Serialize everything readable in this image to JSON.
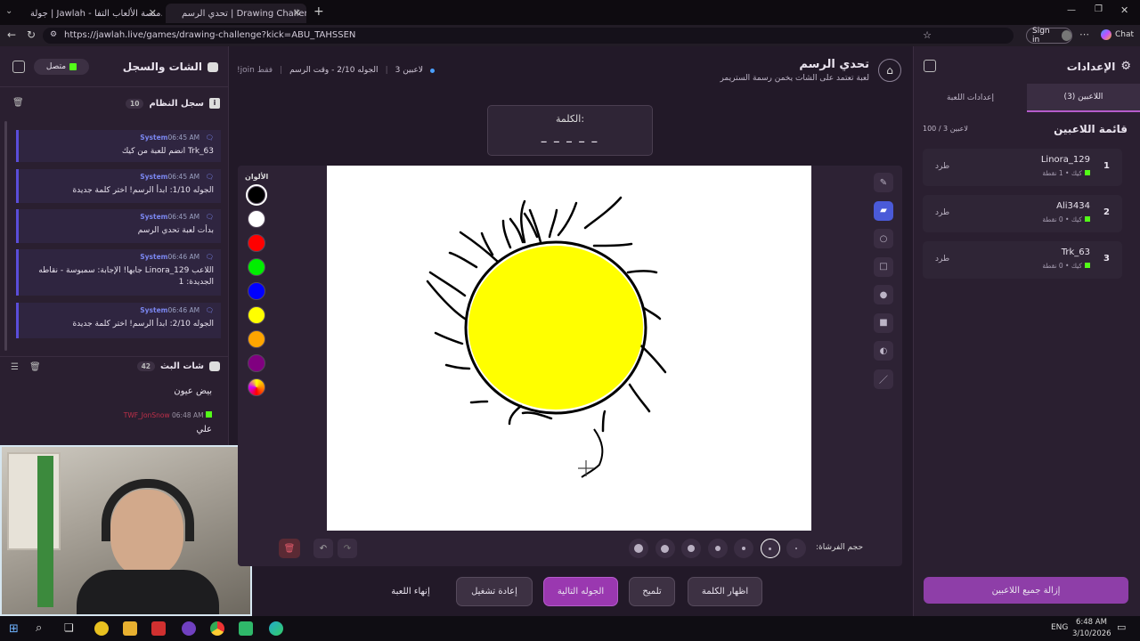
{
  "browser": {
    "tab1_title": "جولة | Jawlah - منصة الألعاب التفا...",
    "tab2_title": "تحدي الرسم | Drawing Challenge",
    "url": "https://jawlah.live/games/drawing-challenge?kick=ABU_TAHSSEN",
    "signin_label": "Sign in",
    "chat_label": "Chat"
  },
  "left_panel": {
    "title": "الشات والسجل",
    "status_label": "متصل",
    "system_log_title": "سجل النظام",
    "system_log_count": "10",
    "messages": [
      {
        "sender": "System",
        "time": "06:45 AM",
        "text": "Trk_63 انضم للعبة من كيك"
      },
      {
        "sender": "System",
        "time": "06:45 AM",
        "text": "الجوله 1/10: ابدأ الرسم! اختر كلمة جديدة"
      },
      {
        "sender": "System",
        "time": "06:45 AM",
        "text": "بدأت لعبة تحدي الرسم"
      },
      {
        "sender": "System",
        "time": "06:46 AM",
        "text": "اللاعب Linora_129 جابها! الإجابة: سمبوسة - نقاطه الجديدة: 1"
      },
      {
        "sender": "System",
        "time": "06:46 AM",
        "text": "الجوله 2/10: ابدأ الرسم! اختر كلمة جديدة"
      }
    ],
    "stream_chat_title": "شات البث",
    "stream_chat_count": "42",
    "chat_messages": [
      {
        "user": "",
        "time": "",
        "text": "بيض عيون"
      },
      {
        "user": "TWF_JonSnow",
        "time": "06:48 AM",
        "text": "علي"
      }
    ]
  },
  "game": {
    "title": "تحدي الرسم",
    "subtitle": "لعبة تعتمد على الشات يخمن رسمة الستريمر",
    "players_count": "3 لاعبين",
    "round_info": "الجوله 2/10 - وقت الرسم",
    "join_hint": "!join فقط",
    "word_label": "الكلمة:",
    "word_mask": "_ _ _ _ _",
    "colors_label": "الألوان",
    "colors": [
      "#000000",
      "#ffffff",
      "#ff0000",
      "#00ee00",
      "#0000ff",
      "#ffff00",
      "#ffa500",
      "#800080"
    ],
    "brush_size_label": "حجم الفرشاة:",
    "tools": [
      "pen-icon",
      "eraser-icon",
      "circle-outline-icon",
      "rectangle-outline-icon",
      "circle-fill-icon",
      "rectangle-fill-icon",
      "fill-bucket-icon",
      "line-icon"
    ],
    "buttons": {
      "reveal_word": "اظهار الكلمة",
      "hint": "تلميح",
      "next_round": "الجوله التالية",
      "restart": "إعادة تشغيل",
      "end_game": "إنهاء اللعبة"
    }
  },
  "right_panel": {
    "title": "الإعدادات",
    "tab_players": "اللاعبين (3)",
    "tab_game_settings": "إعدادات اللعبة",
    "players_list_title": "قائمة اللاعبين",
    "players_capacity": "100 / 3 لاعبين",
    "players": [
      {
        "rank": "1",
        "name": "Linora_129",
        "info": "كيك • 1 نقطة",
        "kick_label": "طرد"
      },
      {
        "rank": "2",
        "name": "Ali3434",
        "info": "كيك • 0 نقطة",
        "kick_label": "طرد"
      },
      {
        "rank": "3",
        "name": "Trk_63",
        "info": "كيك • 0 نقطة",
        "kick_label": "طرد"
      }
    ],
    "remove_all_label": "إزالة جميع اللاعبين"
  },
  "taskbar": {
    "lang": "ENG",
    "time": "6:48 AM",
    "date": "3/10/2026"
  },
  "colors_theme": {
    "accent": "#8e3ea8",
    "kick_green": "#53fc18",
    "system_blue": "#5a4dd9"
  }
}
